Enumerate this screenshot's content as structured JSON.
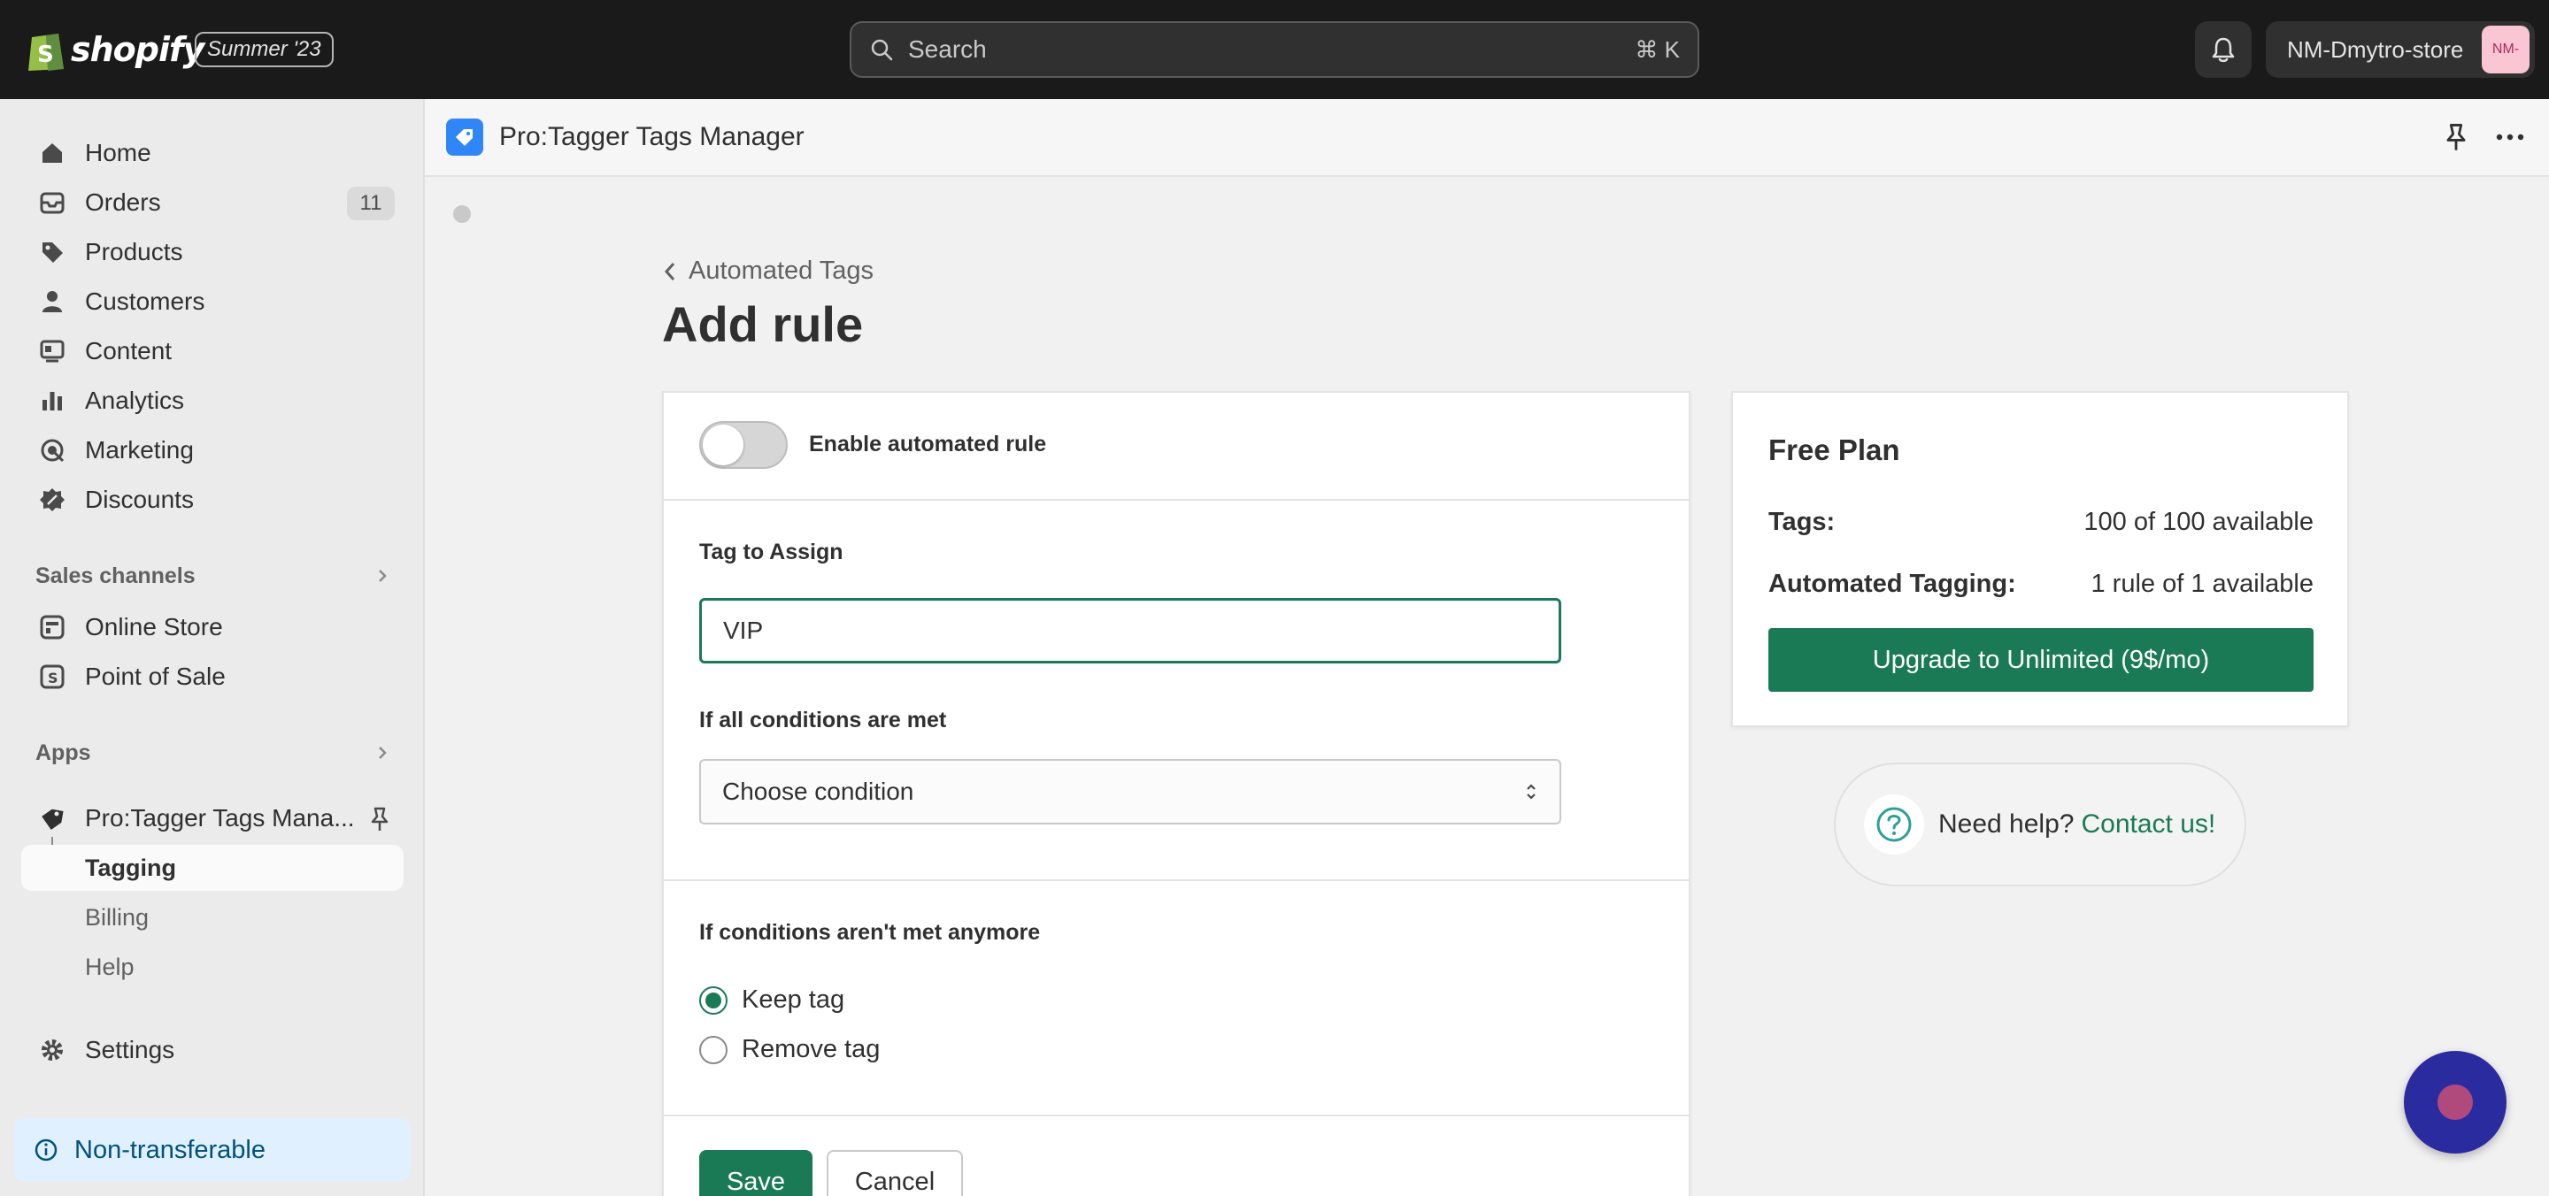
{
  "topbar": {
    "brand": "shopify",
    "edition": "Summer '23",
    "search_placeholder": "Search",
    "search_shortcut": "⌘ K",
    "store_name": "NM-Dmytro-store",
    "avatar_initials": "NM-"
  },
  "sidebar": {
    "items": [
      {
        "label": "Home",
        "icon": "home-icon"
      },
      {
        "label": "Orders",
        "icon": "orders-icon",
        "badge": "11"
      },
      {
        "label": "Products",
        "icon": "tag-icon"
      },
      {
        "label": "Customers",
        "icon": "person-icon"
      },
      {
        "label": "Content",
        "icon": "content-icon"
      },
      {
        "label": "Analytics",
        "icon": "bar-chart-icon"
      },
      {
        "label": "Marketing",
        "icon": "target-icon"
      },
      {
        "label": "Discounts",
        "icon": "discount-icon"
      }
    ],
    "sales_channels_heading": "Sales channels",
    "sales_channels": [
      {
        "label": "Online Store",
        "icon": "store-icon"
      },
      {
        "label": "Point of Sale",
        "icon": "pos-icon"
      }
    ],
    "apps_heading": "Apps",
    "app_name": "Pro:Tagger Tags Mana...",
    "app_sub": [
      {
        "label": "Tagging",
        "active": true
      },
      {
        "label": "Billing"
      },
      {
        "label": "Help"
      }
    ],
    "settings_label": "Settings",
    "non_transferable": "Non-transferable"
  },
  "app_header": {
    "title": "Pro:Tagger Tags Manager"
  },
  "main": {
    "breadcrumb": "Automated Tags",
    "page_title": "Add rule",
    "toggle_label": "Enable automated rule",
    "toggle_on": false,
    "tag_label": "Tag to Assign",
    "tag_value": "VIP",
    "conditions_label": "If all conditions are met",
    "condition_select": "Choose condition",
    "unmet_label": "If conditions aren't met anymore",
    "radio_options": [
      {
        "label": "Keep tag",
        "checked": true
      },
      {
        "label": "Remove tag",
        "checked": false
      }
    ],
    "save_label": "Save",
    "cancel_label": "Cancel"
  },
  "plan": {
    "title": "Free Plan",
    "tags_label": "Tags:",
    "tags_value": "100 of 100 available",
    "auto_label": "Automated Tagging:",
    "auto_value": "1 rule of 1 available",
    "upgrade_label": "Upgrade to Unlimited (9$/mo)"
  },
  "help": {
    "text": "Need help?",
    "link": "Contact us!"
  },
  "colors": {
    "primary": "#1a7a56",
    "topbar": "#1a1a1a",
    "app_icon": "#2f86f6",
    "chat": "#2b2ba0"
  }
}
